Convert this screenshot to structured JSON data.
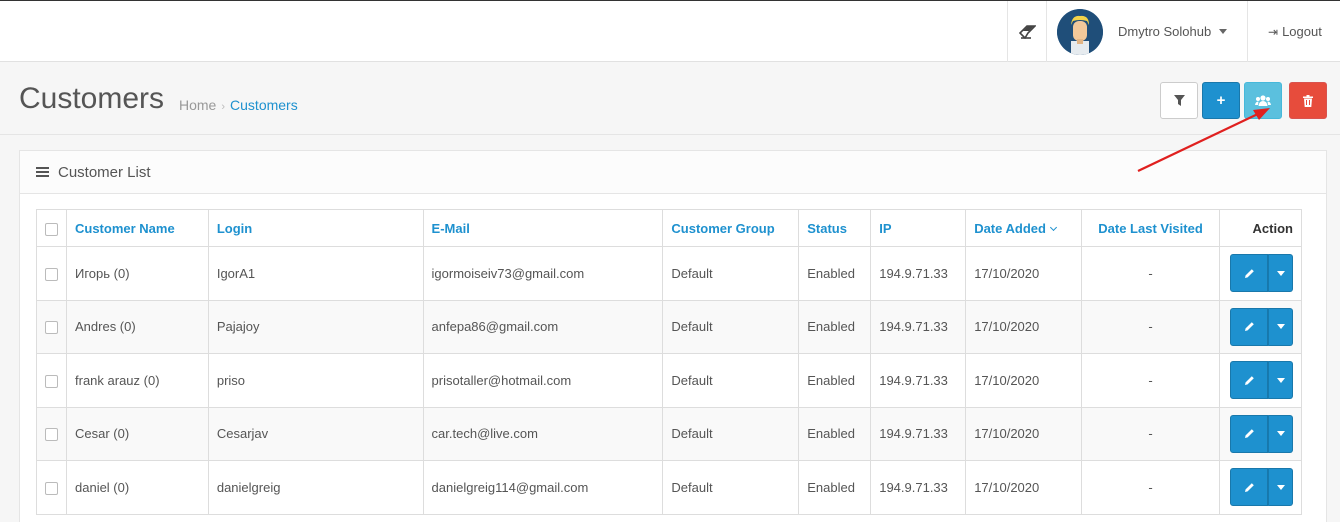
{
  "header": {
    "user_name": "Dmytro Solohub",
    "logout_label": "Logout"
  },
  "page": {
    "title": "Customers",
    "breadcrumb": {
      "home": "Home",
      "current": "Customers"
    }
  },
  "panel": {
    "title": "Customer List"
  },
  "table": {
    "columns": [
      "Customer Name",
      "Login",
      "E-Mail",
      "Customer Group",
      "Status",
      "IP",
      "Date Added",
      "Date Last Visited",
      "Action"
    ],
    "rows": [
      {
        "name": "Игорь (0)",
        "login": "IgorA1",
        "email": "igormoiseiv73@gmail.com",
        "group": "Default",
        "status": "Enabled",
        "ip": "194.9.71.33",
        "date_added": "17/10/2020",
        "last_visited": "-"
      },
      {
        "name": "Andres (0)",
        "login": "Pajajoy",
        "email": "anfepa86@gmail.com",
        "group": "Default",
        "status": "Enabled",
        "ip": "194.9.71.33",
        "date_added": "17/10/2020",
        "last_visited": "-"
      },
      {
        "name": "frank arauz (0)",
        "login": "priso",
        "email": "prisotaller@hotmail.com",
        "group": "Default",
        "status": "Enabled",
        "ip": "194.9.71.33",
        "date_added": "17/10/2020",
        "last_visited": "-"
      },
      {
        "name": "Cesar (0)",
        "login": "Cesarjav",
        "email": "car.tech@live.com",
        "group": "Default",
        "status": "Enabled",
        "ip": "194.9.71.33",
        "date_added": "17/10/2020",
        "last_visited": "-"
      },
      {
        "name": "daniel (0)",
        "login": "danielgreig",
        "email": "danielgreig114@gmail.com",
        "group": "Default",
        "status": "Enabled",
        "ip": "194.9.71.33",
        "date_added": "17/10/2020",
        "last_visited": "-"
      }
    ]
  },
  "colors": {
    "primary": "#1e91cf",
    "info": "#5bc0de",
    "danger": "#e74c3c",
    "annotation_arrow": "#e0201f"
  },
  "icons": [
    "eraser-icon",
    "user-avatar",
    "caret-down-icon",
    "sign-out-icon",
    "filter-icon",
    "plus-icon",
    "users-icon",
    "trash-icon",
    "list-icon",
    "pencil-icon"
  ]
}
